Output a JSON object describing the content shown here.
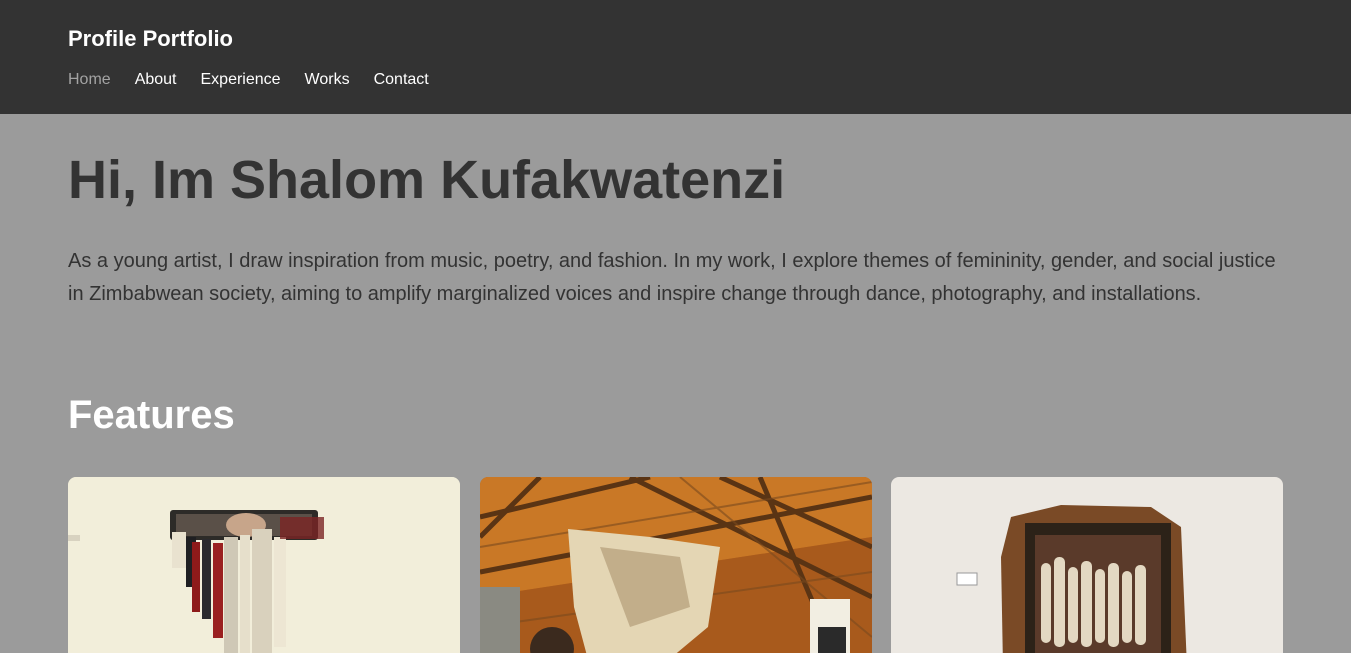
{
  "header": {
    "brand": "Profile Portfolio",
    "nav": [
      {
        "label": "Home",
        "active": true
      },
      {
        "label": "About",
        "active": false
      },
      {
        "label": "Experience",
        "active": false
      },
      {
        "label": "Works",
        "active": false
      },
      {
        "label": "Contact",
        "active": false
      }
    ]
  },
  "hero": {
    "title": "Hi, Im Shalom Kufakwatenzi",
    "text": "As a young artist, I draw inspiration from music, poetry, and fashion. In my work, I explore themes of femininity, gender, and social justice in Zimbabwean society, aiming to amplify marginalized voices and inspire change through dance, photography, and installations."
  },
  "features": {
    "title": "Features",
    "cards": [
      {
        "image": "woven-textile-wall-hanging-photo"
      },
      {
        "image": "thatched-roof-textile-installation-photo"
      },
      {
        "image": "framed-figures-textile-artwork-photo"
      }
    ]
  },
  "colors": {
    "navbar": "#333333",
    "page_overlay": "#9b9b9b",
    "heading_dark": "#333333",
    "heading_light": "#ffffff",
    "nav_active": "#a3a3a3"
  }
}
